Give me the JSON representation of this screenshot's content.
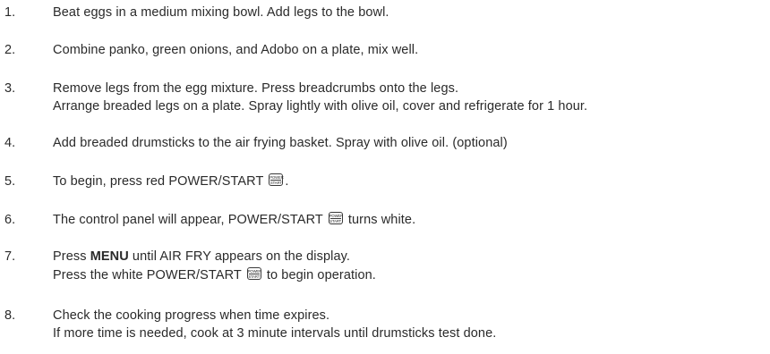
{
  "steps": [
    {
      "num": "1.",
      "lines": [
        "Beat eggs in a medium mixing bowl. Add legs to the bowl."
      ]
    },
    {
      "num": "2.",
      "lines": [
        "Combine panko, green onions, and Adobo on a plate, mix well."
      ]
    },
    {
      "num": "3.",
      "lines": [
        "Remove legs from the egg mixture. Press breadcrumbs onto the legs.",
        "Arrange breaded legs on a plate. Spray lightly with olive oil, cover and refrigerate for 1 hour."
      ]
    },
    {
      "num": "4.",
      "lines": [
        "Add breaded drumsticks to the air frying basket. Spray with olive oil. (optional)"
      ]
    },
    {
      "num": "5.",
      "before": "To begin, press red POWER/START",
      "after": "."
    },
    {
      "num": "6.",
      "before": "The control panel will appear, POWER/START",
      "after": "turns white."
    },
    {
      "num": "7.",
      "line1_prefix": "Press ",
      "line1_bold": "MENU",
      "line1_suffix": " until AIR FRY appears on the display.",
      "line2_before": "Press the white POWER/START",
      "line2_after": "to begin operation."
    },
    {
      "num": "8.",
      "lines": [
        "Check the cooking progress when time expires.",
        "If more time is needed, cook at 3 minute intervals until drumsticks test done."
      ]
    }
  ],
  "power_button_icon": {
    "icon": "power-start-button-icon",
    "top_label": "POWER",
    "bottom_label": "START"
  }
}
